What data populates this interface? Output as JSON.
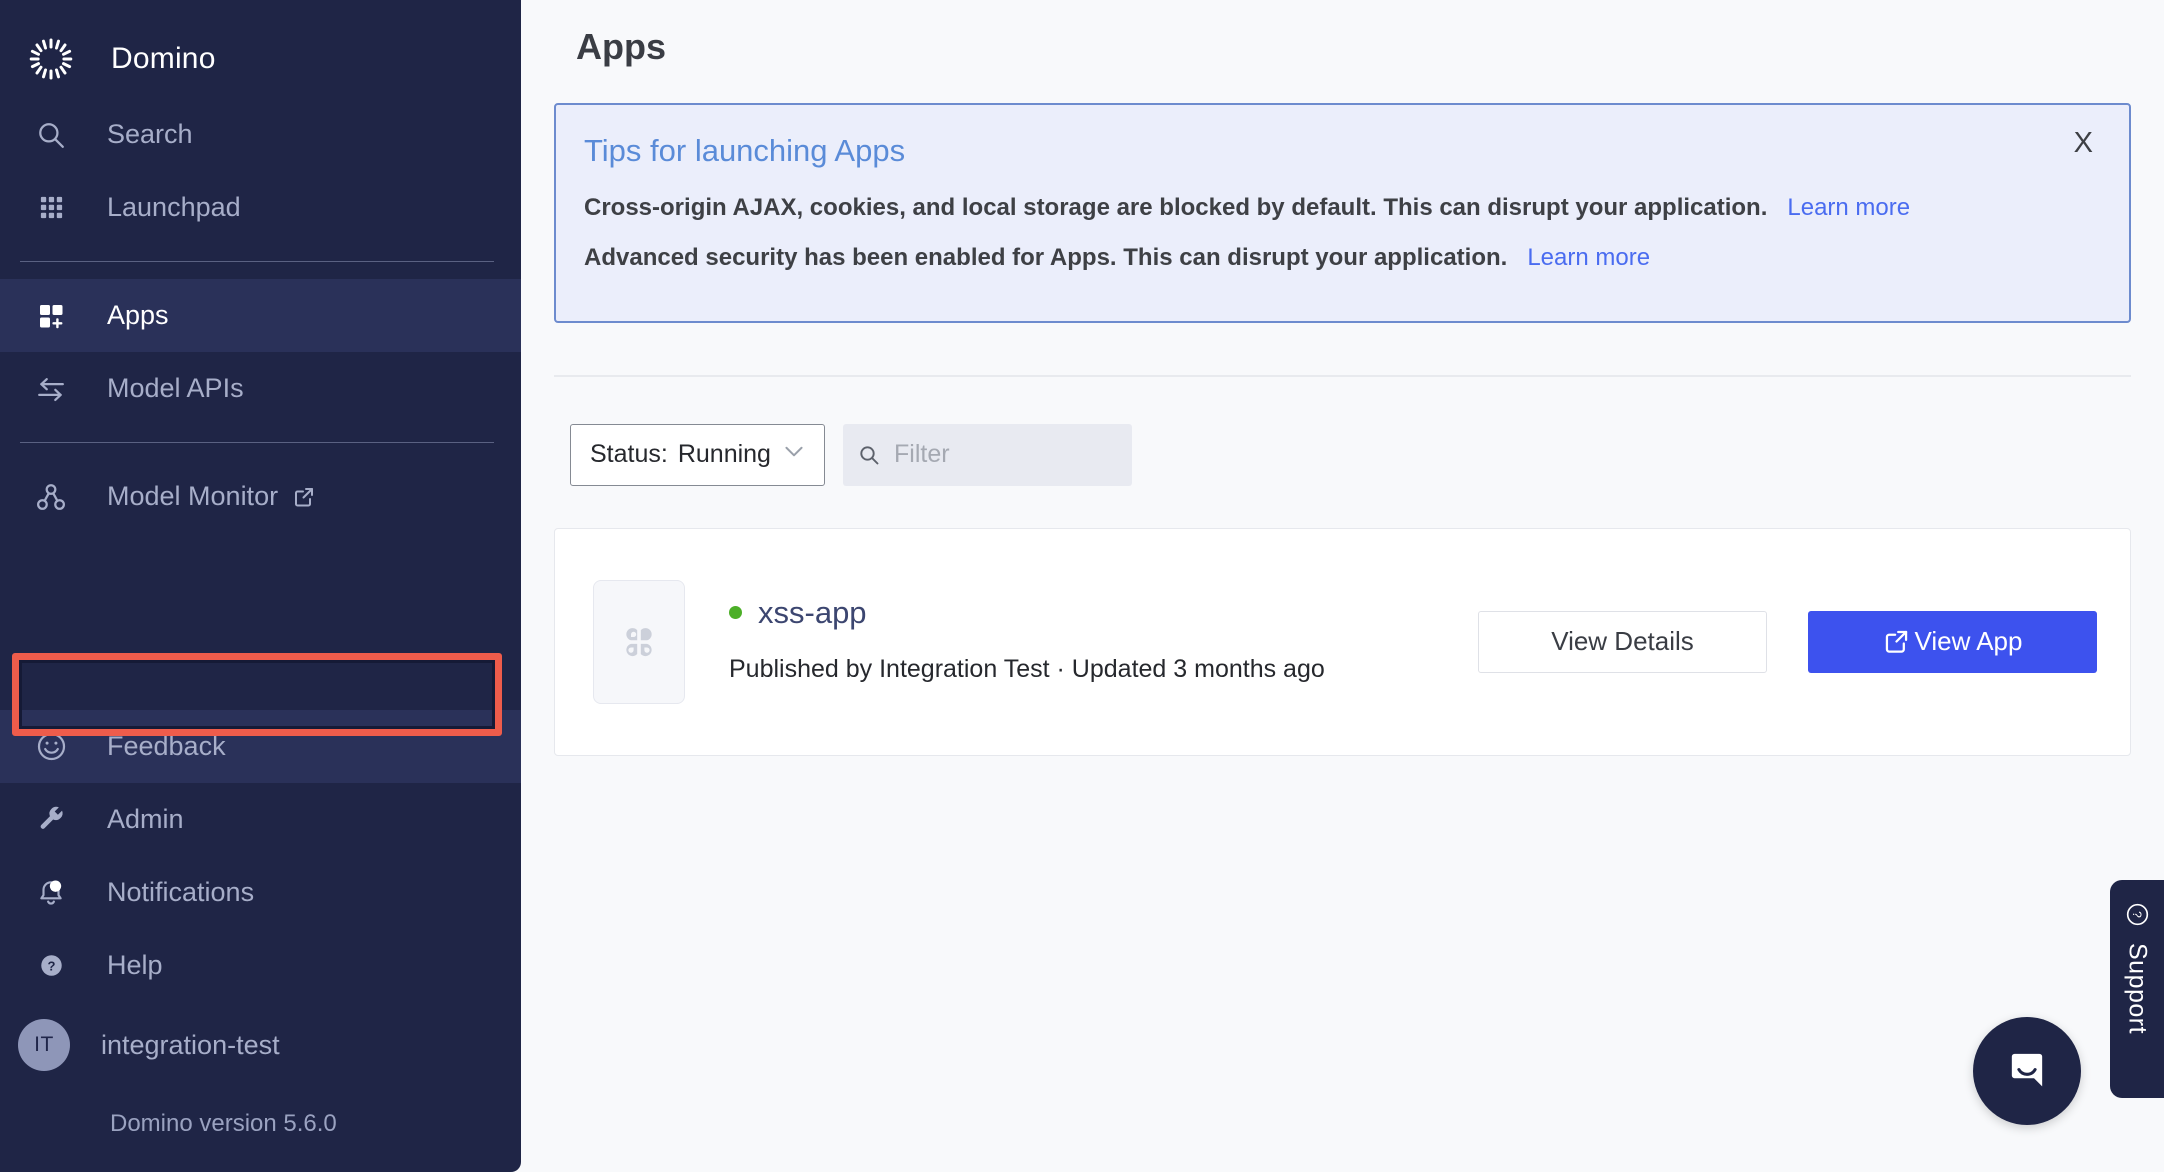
{
  "sidebar": {
    "brand": {
      "name": "Domino",
      "logo_icon": "domino-spinner-logo"
    },
    "items": [
      {
        "label": "Search",
        "icon": "search-icon",
        "state": "default"
      },
      {
        "label": "Launchpad",
        "icon": "grid-apps-icon",
        "state": "default"
      },
      {
        "label": "Apps",
        "icon": "apps-plus-icon",
        "state": "active"
      },
      {
        "label": "Model APIs",
        "icon": "exchange-arrows-icon",
        "state": "default"
      },
      {
        "label": "Model Monitor",
        "icon": "node-graph-icon",
        "state": "default",
        "external": true
      },
      {
        "label": "Feedback",
        "icon": "smiley-face-icon",
        "state": "hovered",
        "highlighted": true
      },
      {
        "label": "Admin",
        "icon": "wrench-icon",
        "state": "default"
      },
      {
        "label": "Notifications",
        "icon": "bell-icon",
        "state": "default"
      },
      {
        "label": "Help",
        "icon": "question-circle-icon",
        "state": "default"
      }
    ],
    "user": {
      "initials": "IT",
      "name": "integration-test"
    },
    "version": "Domino version 5.6.0"
  },
  "header": {
    "title": "Apps"
  },
  "banner": {
    "title": "Tips for launching Apps",
    "close_label": "X",
    "rows": [
      {
        "text": "Cross-origin AJAX, cookies, and local storage are blocked by default. This can disrupt your application.",
        "link": "Learn more"
      },
      {
        "text": "Advanced security has been enabled for Apps. This can disrupt your application.",
        "link": "Learn more"
      }
    ]
  },
  "filters": {
    "status": {
      "key": "Status:",
      "value": "Running",
      "chevron_icon": "chevron-down-icon"
    },
    "search": {
      "value": "",
      "placeholder": "Filter",
      "icon": "search-icon"
    }
  },
  "apps": [
    {
      "thumbnail_icon": "clover-app-icon",
      "status_dot": "running",
      "name": "xss-app",
      "meta": "Published by Integration Test · Updated 3 months ago",
      "details_button": "View Details",
      "open_button": "View App",
      "open_button_icon": "external-link-icon"
    }
  ],
  "support": {
    "label": "Support",
    "icon": "question-circle-icon"
  },
  "chat": {
    "icon": "chat-bubble-smile-icon"
  },
  "colors": {
    "sidebar_bg": "#1f2546",
    "sidebar_active": "#2a3159",
    "accent_blue": "#3d52ee",
    "link_blue": "#4a6cf0",
    "banner_bg": "#ebeefb",
    "banner_border": "#6d8bce",
    "banner_title": "#5a8bd8",
    "status_green": "#4caf28",
    "highlight_red": "#ee5c4b",
    "app_name": "#3c4670"
  }
}
